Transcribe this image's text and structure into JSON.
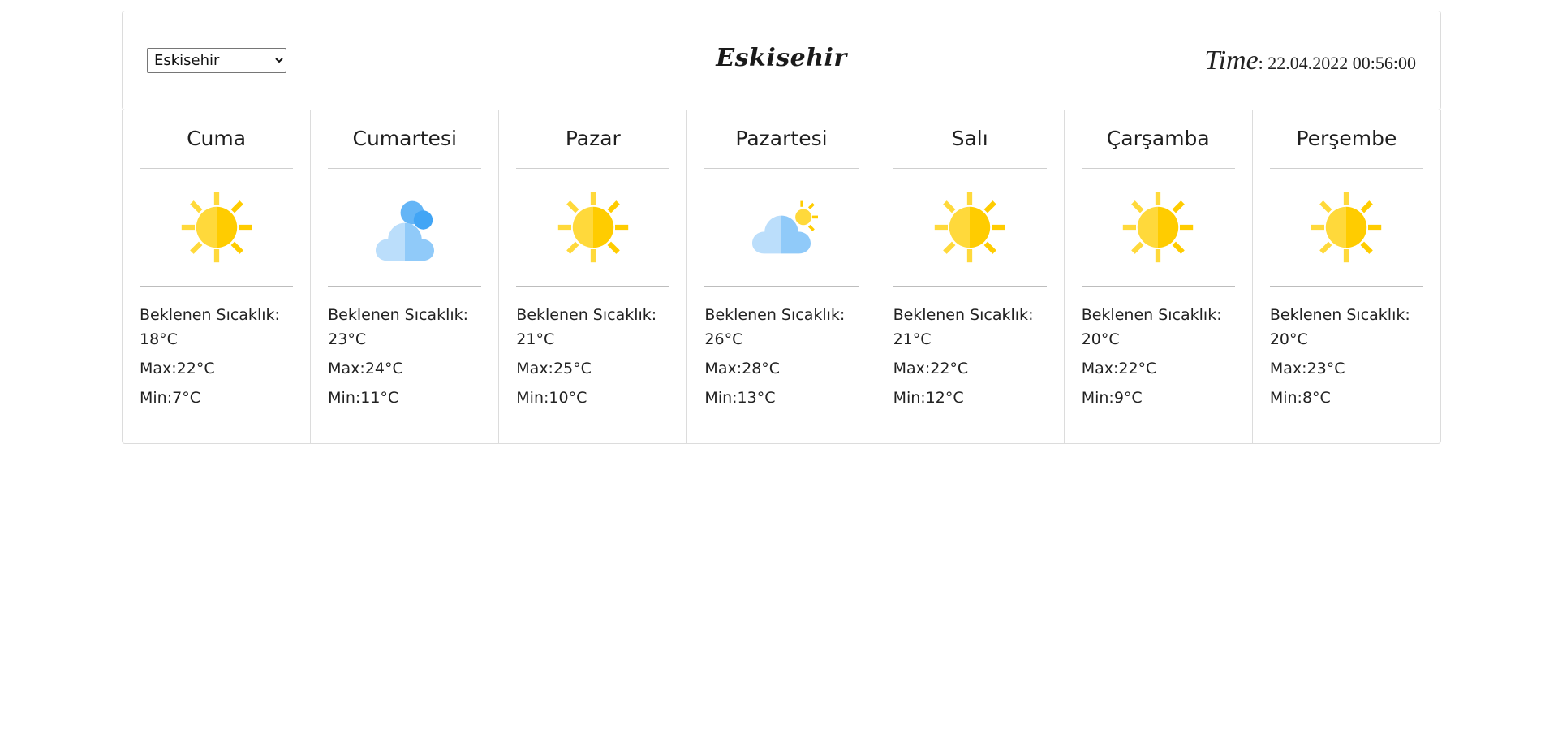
{
  "header": {
    "select": {
      "selected": "Eskisehir",
      "options": [
        "Eskisehir"
      ]
    },
    "title": "Eskisehir",
    "time_label": "Time",
    "time_value": ": 22.04.2022 00:56:00"
  },
  "labels": {
    "expected": "Beklenen Sıcaklık:",
    "max_prefix": "Max:",
    "min_prefix": "Min:"
  },
  "days": [
    {
      "name": "Cuma",
      "icon": "sun-icon",
      "expected": "18°C",
      "max": "Max:22°C",
      "min": "Min:7°C"
    },
    {
      "name": "Cumartesi",
      "icon": "clouds-icon",
      "expected": "23°C",
      "max": "Max:24°C",
      "min": "Min:11°C"
    },
    {
      "name": "Pazar",
      "icon": "sun-icon",
      "expected": "21°C",
      "max": "Max:25°C",
      "min": "Min:10°C"
    },
    {
      "name": "Pazartesi",
      "icon": "partly-cloudy-icon",
      "expected": "26°C",
      "max": "Max:28°C",
      "min": "Min:13°C"
    },
    {
      "name": "Salı",
      "icon": "sun-icon",
      "expected": "21°C",
      "max": "Max:22°C",
      "min": "Min:12°C"
    },
    {
      "name": "Çarşamba",
      "icon": "sun-icon",
      "expected": "20°C",
      "max": "Max:22°C",
      "min": "Min:9°C"
    },
    {
      "name": "Perşembe",
      "icon": "sun-icon",
      "expected": "20°C",
      "max": "Max:23°C",
      "min": "Min:8°C"
    }
  ],
  "colors": {
    "sun_light": "#FFD93B",
    "sun_dark": "#FFCC00",
    "cloud_light": "#BBDEFB",
    "cloud_mid": "#90CAF9",
    "cloud_dark": "#64B5F6"
  }
}
